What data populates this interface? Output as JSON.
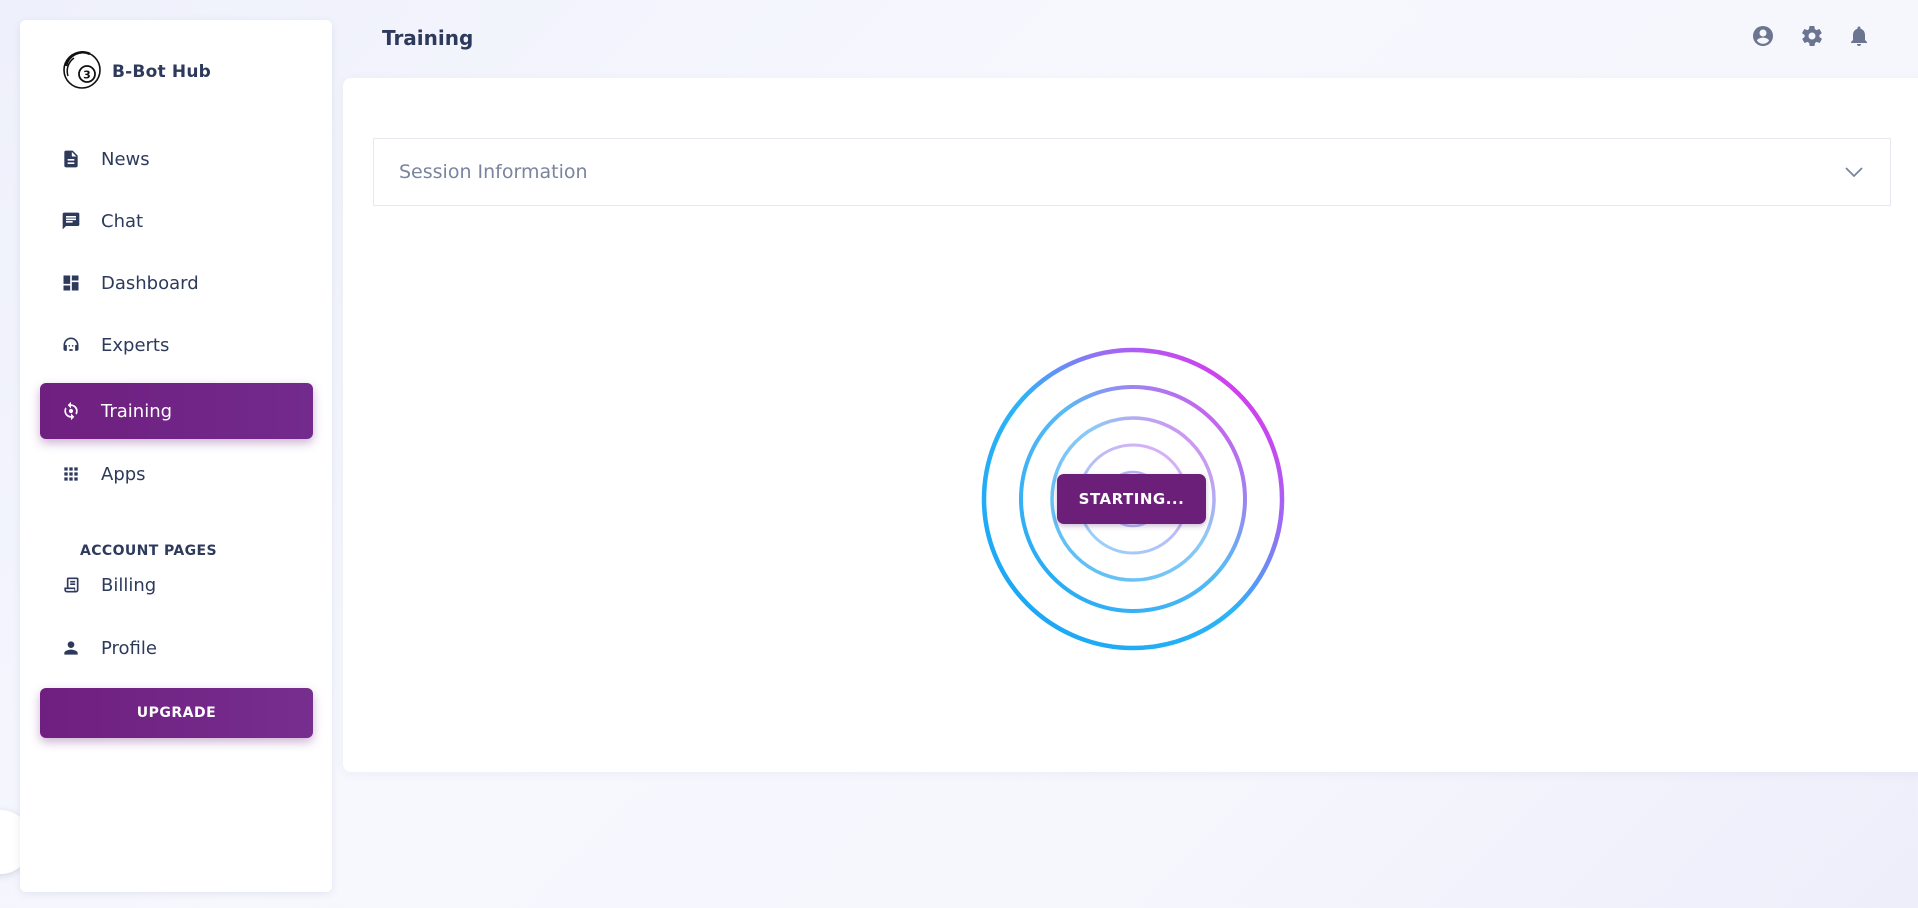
{
  "app": {
    "brand": "B-Bot Hub",
    "page_title": "Training"
  },
  "sidebar": {
    "items": [
      {
        "label": "News",
        "icon": "news-icon"
      },
      {
        "label": "Chat",
        "icon": "chat-icon"
      },
      {
        "label": "Dashboard",
        "icon": "dashboard-icon"
      },
      {
        "label": "Experts",
        "icon": "experts-icon"
      },
      {
        "label": "Training",
        "icon": "training-icon",
        "active": true
      },
      {
        "label": "Apps",
        "icon": "apps-icon"
      }
    ],
    "section_title": "ACCOUNT PAGES",
    "account_items": [
      {
        "label": "Billing",
        "icon": "billing-icon"
      },
      {
        "label": "Profile",
        "icon": "profile-icon"
      }
    ],
    "upgrade_label": "UPGRADE"
  },
  "header": {
    "icons": [
      "account-icon",
      "gear-icon",
      "bell-icon"
    ]
  },
  "main": {
    "accordion_title": "Session Information",
    "status_label": "STARTING..."
  },
  "colors": {
    "accent": "#6f1f7f",
    "ring_start": "#16a3f5",
    "ring_end": "#ff1ae8",
    "text": "#2d3a5c"
  }
}
